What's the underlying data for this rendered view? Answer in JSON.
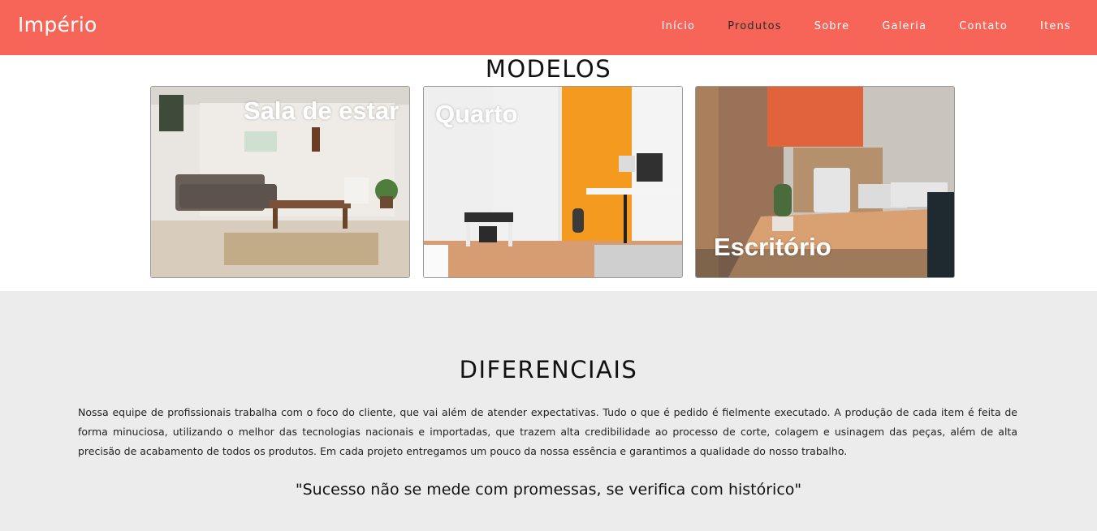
{
  "brand": "Império",
  "nav": {
    "items": [
      "Início",
      "Produtos",
      "Sobre",
      "Galeria",
      "Contato",
      "Itens"
    ],
    "active": "Produtos"
  },
  "models": {
    "title": "MODELOS",
    "cards": [
      {
        "label": "Sala de estar"
      },
      {
        "label": "Quarto"
      },
      {
        "label": "Escritório"
      }
    ]
  },
  "diferenciais": {
    "title": "DIFERENCIAIS",
    "text": "Nossa equipe de profissionais trabalha com o foco do cliente, que vai além de atender expectativas. Tudo o que é pedido é fielmente executado. A produção de cada item é feita de forma minuciosa, utilizando o melhor das tecnologias nacionais e importadas, que trazem alta credibilidade ao processo de corte, colagem e usinagem das peças, além de alta precisão de acabamento de todos os produtos. Em cada projeto entregamos um pouco da nossa essência e garantimos a qualidade do nosso trabalho.",
    "quote": "\"Sucesso não se mede com promessas, se verifica com histórico\""
  },
  "colors": {
    "navbar": "#f76559",
    "section_bg": "#ececec"
  }
}
